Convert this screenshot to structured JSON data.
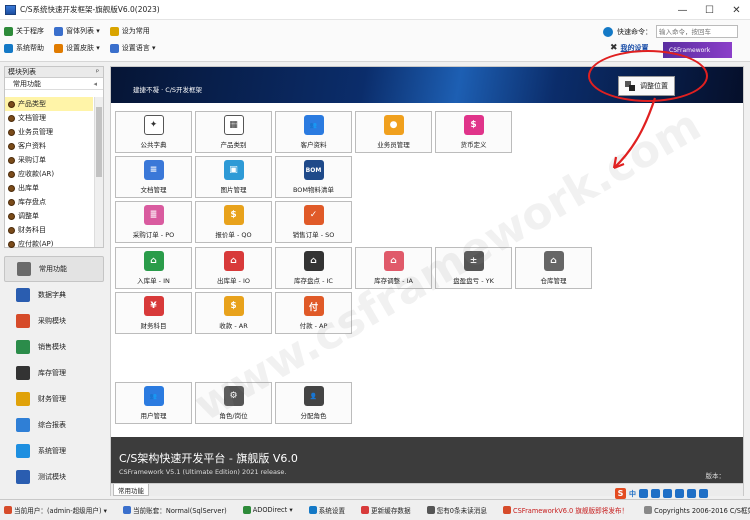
{
  "window": {
    "title": "C/S系统快速开发框架-旗舰版V6.0(2023)"
  },
  "menu": {
    "row1": [
      {
        "label": "关于程序",
        "color": "#2e8b3a"
      },
      {
        "label": "窗体列表 ▾",
        "color": "#3a6fcc"
      },
      {
        "label": "设为常用",
        "color": "#d9a400"
      }
    ],
    "row2": [
      {
        "label": "系统帮助",
        "color": "#1479c6"
      },
      {
        "label": "设置皮肤 ▾",
        "color": "#e07b00"
      },
      {
        "label": "设置语言 ▾",
        "color": "#3a6fcc"
      }
    ]
  },
  "quick": {
    "label": "快速命令：",
    "placeholder": "输入命令，按回车"
  },
  "mysettings": "我的设置",
  "brand": "CSFramework",
  "left": {
    "header": "模块列表",
    "pin": "ᵖ",
    "section": "常用功能",
    "tree": [
      "产品类型",
      "文档管理",
      "业务员管理",
      "客户资料",
      "采购订单",
      "应收款(AR)",
      "出库单",
      "库存盘点",
      "调整单",
      "财务科目",
      "应付款(AP)"
    ],
    "nav": [
      {
        "label": "常用功能",
        "color": "#6a6a6a"
      },
      {
        "label": "数据字典",
        "color": "#2a5db0"
      },
      {
        "label": "采购模块",
        "color": "#d64b2a"
      },
      {
        "label": "销售模块",
        "color": "#2b8c4a"
      },
      {
        "label": "库存管理",
        "color": "#333333"
      },
      {
        "label": "财务管理",
        "color": "#e0a20a"
      },
      {
        "label": "综合报表",
        "color": "#2f7fd6"
      },
      {
        "label": "系统管理",
        "color": "#1e8fe0"
      },
      {
        "label": "测试模块",
        "color": "#2a5db0"
      }
    ]
  },
  "banner": {
    "breadcrumb": "建捷不凝 · C/S开发框架",
    "adjust": "调整位置"
  },
  "tiles": [
    {
      "label": "公共字典",
      "color": "#ffffff",
      "fg": "#333",
      "glyph": "✦"
    },
    {
      "label": "产品类别",
      "color": "#ffffff",
      "fg": "#333",
      "glyph": "▦"
    },
    {
      "label": "客户资料",
      "color": "#2b7be0",
      "fg": "#fff",
      "glyph": "👥"
    },
    {
      "label": "业务员管理",
      "color": "#f0a01e",
      "fg": "#fff",
      "glyph": "●"
    },
    {
      "label": "货币定义",
      "color": "#e0348a",
      "fg": "#fff",
      "glyph": "$"
    },
    {
      "label": "文档管理",
      "color": "#3a78d8",
      "fg": "#fff",
      "glyph": "≡"
    },
    {
      "label": "图片管理",
      "color": "#2e9ad6",
      "fg": "#fff",
      "glyph": "▣"
    },
    {
      "label": "BOM物料清单",
      "color": "#1f4a8a",
      "fg": "#fff",
      "glyph": "BOM"
    },
    {
      "label": "采购订单 - PO",
      "color": "#d95b9f",
      "fg": "#fff",
      "glyph": "≣"
    },
    {
      "label": "报价单 - QO",
      "color": "#e8a21c",
      "fg": "#fff",
      "glyph": "$"
    },
    {
      "label": "销售订单 - SO",
      "color": "#e05a28",
      "fg": "#fff",
      "glyph": "✓"
    },
    {
      "label": "入库单 - IN",
      "color": "#2a9c4a",
      "fg": "#fff",
      "glyph": "⌂"
    },
    {
      "label": "出库单 - IO",
      "color": "#d83a3a",
      "fg": "#fff",
      "glyph": "⌂"
    },
    {
      "label": "库存盘点 - IC",
      "color": "#333333",
      "fg": "#fff",
      "glyph": "⌂"
    },
    {
      "label": "库存调整 - IA",
      "color": "#e05a6a",
      "fg": "#fff",
      "glyph": "⌂"
    },
    {
      "label": "盘盈盘亏 - YK",
      "color": "#555555",
      "fg": "#fff",
      "glyph": "±"
    },
    {
      "label": "仓库管理",
      "color": "#666666",
      "fg": "#fff",
      "glyph": "⌂"
    },
    {
      "label": "财务科目",
      "color": "#d83a3a",
      "fg": "#fff",
      "glyph": "¥"
    },
    {
      "label": "收款 - AR",
      "color": "#e8a21c",
      "fg": "#fff",
      "glyph": "$"
    },
    {
      "label": "付款 - AP",
      "color": "#e05a28",
      "fg": "#fff",
      "glyph": "付"
    },
    {
      "label": "用户管理",
      "color": "#2b7be0",
      "fg": "#fff",
      "glyph": "👥"
    },
    {
      "label": "角色/岗位",
      "color": "#555555",
      "fg": "#fff",
      "glyph": "⚙"
    },
    {
      "label": "分配角色",
      "color": "#444444",
      "fg": "#fff",
      "glyph": "👤"
    }
  ],
  "footer": {
    "title": "C/S架构快速开发平台 - 旗舰版 V6.0",
    "subtitle": "CSFramework V5.1 (Ultimate Edition) 2021 release.",
    "version": "版本："
  },
  "tab": "常用功能",
  "ime": {
    "s": "S",
    "lang": "中"
  },
  "status": [
    {
      "label": "当前用户：(admin-超级用户) ▾",
      "color": "#d64b2a",
      "red": false
    },
    {
      "label": "当前账套：Normal(SqlServer)",
      "color": "#3a6fcc",
      "red": false
    },
    {
      "label": "ADODirect ▾",
      "color": "#2e8b3a",
      "red": false
    },
    {
      "label": "系统设置",
      "color": "#1479c6",
      "red": false
    },
    {
      "label": "更新缓存数据",
      "color": "#d83a3a",
      "red": false
    },
    {
      "label": "您有0条未读消息",
      "color": "#555555",
      "red": false
    },
    {
      "label": "CSFrameworkV6.0 旗舰版即将发布！",
      "color": "#d64b2a",
      "red": true
    },
    {
      "label": "Copyrights 2006-2016 C/S框架网版权",
      "color": "#888888",
      "red": false
    }
  ],
  "watermark": "www.csframework.com"
}
